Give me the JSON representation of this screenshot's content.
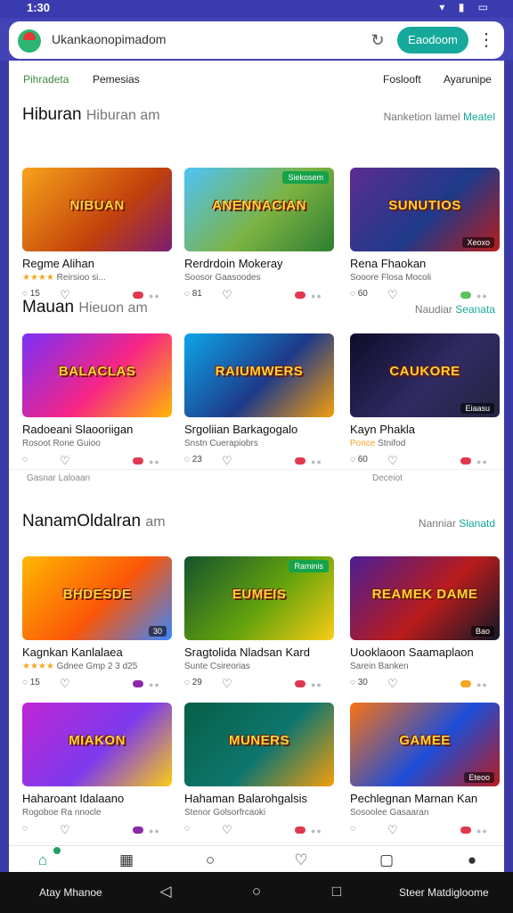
{
  "status": {
    "time": "1:30",
    "icons": "▾ ▮ ▭"
  },
  "browser": {
    "url": "Ukankaonopimadom",
    "go_label": "Eaodoom"
  },
  "tabs": [
    {
      "label": "Pihradeta",
      "active": true
    },
    {
      "label": "Pemesias",
      "active": false
    },
    {
      "label": "Foslooft",
      "active": false
    },
    {
      "label": "Ayarunipe",
      "active": false
    }
  ],
  "sections": [
    {
      "title": "Hiburan",
      "subtitle": "Hiburan am",
      "link": "Nanketion lamel",
      "link_hl": "Meatel",
      "cards": [
        {
          "caption": "NIBUAN",
          "badge": "",
          "corner": "",
          "title": "Regme Alihan",
          "stars": "★★★★",
          "meta": "Reirsioo si...",
          "comments": "15",
          "pill": "#e0394f"
        },
        {
          "caption": "ANENNACIAN",
          "badge": "Siekosem",
          "corner": "",
          "title": "Rerdrdoin Mokeray",
          "stars": "",
          "meta": "Soosor Gaasoodes",
          "comments": "81",
          "pill": "#e0394f"
        },
        {
          "caption": "SUNUTIOS",
          "badge": "",
          "corner": "Xeoxo",
          "title": "Rena Fhaokan",
          "stars": "",
          "meta": "Sooore Flosa Mocoli",
          "comments": "60",
          "pill": "#5bc25b"
        }
      ]
    },
    {
      "title": "Mauan",
      "subtitle": "Hieuon am",
      "link": "Naudiar",
      "link_hl": "Seanata",
      "cards": [
        {
          "caption": "BALACLAS",
          "badge": "",
          "corner": "",
          "title": "Radoeani Slaooriigan",
          "stars": "",
          "meta": "Rosoot Rone Guioo",
          "comments": "",
          "pill": "#e0394f"
        },
        {
          "caption": "RAIUMWERS",
          "badge": "",
          "corner": "",
          "title": "Srgoliian Barkagogalo",
          "stars": "",
          "meta": "Snstn Cuerapiobrs",
          "comments": "23",
          "pill": "#e0394f"
        },
        {
          "caption": "CAUKORE",
          "badge": "",
          "corner": "Eiaasu",
          "title": "Kayn Phakla",
          "stars": "Ponce",
          "meta": "Stnifod",
          "comments": "60",
          "pill": "#e0394f"
        }
      ]
    },
    {
      "title": "NanamOldalran",
      "subtitle": "am",
      "link": "Nanniar",
      "link_hl": "Slanatd",
      "cards": [
        {
          "caption": "BHDESDE",
          "badge": "",
          "corner": "30",
          "title": "Kagnkan Kanlalaea",
          "stars": "★★★★",
          "meta": "Gdnee Gmp 2 3 d25",
          "comments": "15",
          "pill": "#8b2aa8"
        },
        {
          "caption": "EUMEIS",
          "badge": "Raminis",
          "corner": "",
          "title": "Sragtolida Nladsan Kard",
          "stars": "",
          "meta": "Sunte Csireorias",
          "comments": "29",
          "pill": "#e0394f"
        },
        {
          "caption": "REAMEK DAME",
          "badge": "",
          "corner": "Bao",
          "title": "Uooklaoon Saamaplaon",
          "stars": "",
          "meta": "Sarein Banken",
          "comments": "30",
          "pill": "#f5a623"
        }
      ]
    },
    {
      "title": "",
      "subtitle": "",
      "link": "",
      "link_hl": "",
      "cards": [
        {
          "caption": "MIAKON",
          "badge": "",
          "corner": "",
          "title": "Haharoant Idalaano",
          "stars": "",
          "meta": "Rogoboe Ra nnocle",
          "comments": "",
          "pill": "#8b2aa8"
        },
        {
          "caption": "MUNERS",
          "badge": "",
          "corner": "",
          "title": "Hahaman Balarohgalsis",
          "stars": "",
          "meta": "Stenor Golsorfrcaoki",
          "comments": "",
          "pill": "#e0394f"
        },
        {
          "caption": "GAMEE",
          "badge": "",
          "corner": "Eteoo",
          "title": "Pechlegnan Marnan Kan",
          "stars": "",
          "meta": "Sosoolee Gasaaran",
          "comments": "",
          "pill": "#e0394f"
        }
      ]
    }
  ],
  "divider": {
    "left": "Gasnar Laloaan",
    "right": "Deceiot"
  },
  "nav": [
    "home-icon",
    "grid-icon",
    "circle-icon",
    "heart-icon",
    "card-icon",
    "profile-icon"
  ],
  "system": {
    "left": "Atay Mhanoe",
    "right": "Steer Matdigloome"
  }
}
